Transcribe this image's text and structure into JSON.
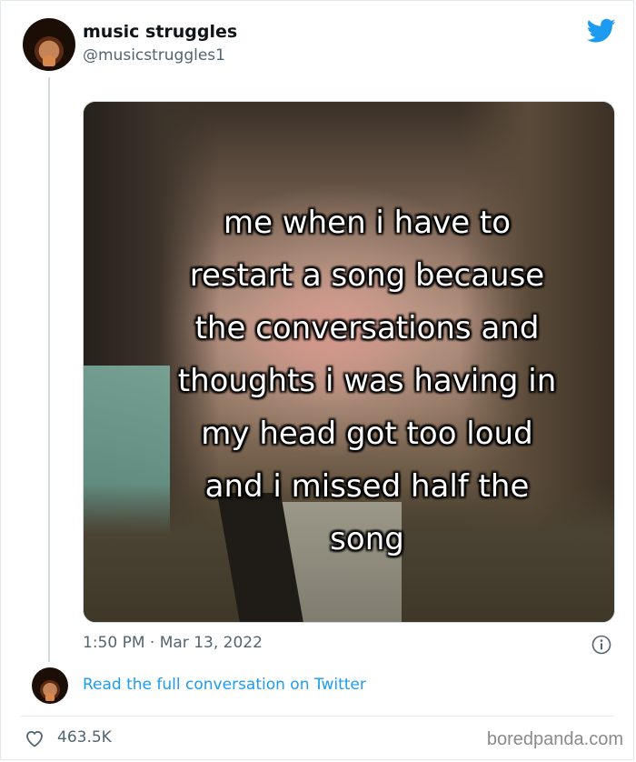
{
  "tweet": {
    "display_name": "music struggles",
    "handle": "@musicstruggles1",
    "meme_text": "me when i have to\nrestart a song because\nthe conversations and\nthoughts i was having in\nmy head got too loud\nand i missed half the\nsong",
    "timestamp": "1:50 PM · Mar 13, 2022",
    "read_link": "Read the full conversation on Twitter",
    "like_count": "463.5K"
  },
  "watermark": "boredpanda.com",
  "colors": {
    "twitter_blue": "#1d9bf0",
    "secondary_text": "#536471"
  },
  "icons": {
    "brand": "twitter-bird-icon",
    "info": "info-icon",
    "like": "heart-icon"
  }
}
